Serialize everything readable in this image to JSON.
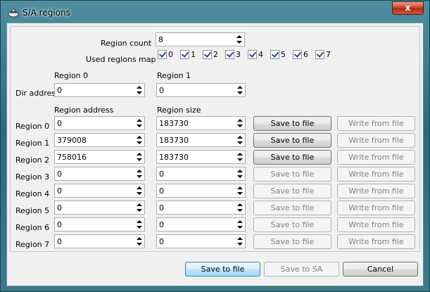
{
  "window": {
    "title": "S/A regions",
    "close_label": "x"
  },
  "labels": {
    "region_count": "Region count",
    "used_regions_map": "Used regions map",
    "region0_header": "Region 0",
    "region1_header": "Region 1",
    "dir_address": "Dir address",
    "region_address_header": "Region address",
    "region_size_header": "Region size"
  },
  "region_count": "8",
  "used_regions": [
    {
      "label": "0",
      "checked": true
    },
    {
      "label": "1",
      "checked": true
    },
    {
      "label": "2",
      "checked": true
    },
    {
      "label": "3",
      "checked": true
    },
    {
      "label": "4",
      "checked": true
    },
    {
      "label": "5",
      "checked": true
    },
    {
      "label": "6",
      "checked": true
    },
    {
      "label": "7",
      "checked": true
    }
  ],
  "dir_address": {
    "region0": "0",
    "region1": "0"
  },
  "regions": [
    {
      "label": "Region 0",
      "address": "0",
      "size": "183730",
      "save_label": "Save to file",
      "write_label": "Write from file",
      "save_enabled": true,
      "write_enabled": false
    },
    {
      "label": "Region 1",
      "address": "379008",
      "size": "183730",
      "save_label": "Save to file",
      "write_label": "Write from file",
      "save_enabled": true,
      "write_enabled": false
    },
    {
      "label": "Region 2",
      "address": "758016",
      "size": "183730",
      "save_label": "Save to file",
      "write_label": "Write from file",
      "save_enabled": true,
      "write_enabled": false
    },
    {
      "label": "Region 3",
      "address": "0",
      "size": "0",
      "save_label": "Save to file",
      "write_label": "Write from file",
      "save_enabled": false,
      "write_enabled": false
    },
    {
      "label": "Region 4",
      "address": "0",
      "size": "0",
      "save_label": "Save to file",
      "write_label": "Write from file",
      "save_enabled": false,
      "write_enabled": false
    },
    {
      "label": "Region 5",
      "address": "0",
      "size": "0",
      "save_label": "Save to file",
      "write_label": "Write from file",
      "save_enabled": false,
      "write_enabled": false
    },
    {
      "label": "Region 6",
      "address": "0",
      "size": "0",
      "save_label": "Save to file",
      "write_label": "Write from file",
      "save_enabled": false,
      "write_enabled": false
    },
    {
      "label": "Region 7",
      "address": "0",
      "size": "0",
      "save_label": "Save to file",
      "write_label": "Write from file",
      "save_enabled": false,
      "write_enabled": false
    }
  ],
  "footer": {
    "save_to_file": "Save to file",
    "save_to_sa": "Save to SA",
    "cancel": "Cancel"
  }
}
